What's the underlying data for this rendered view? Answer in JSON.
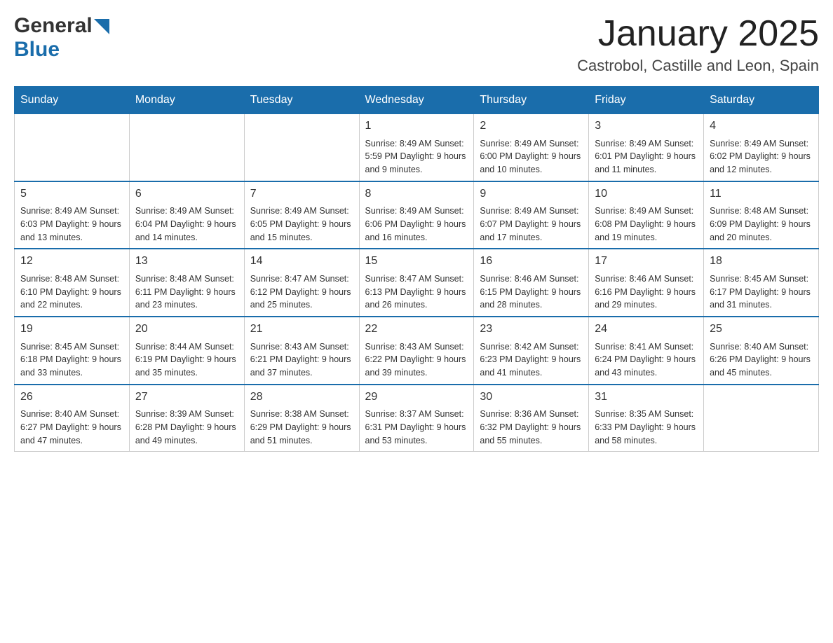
{
  "header": {
    "logo_text1": "General",
    "logo_text2": "Blue",
    "month_title": "January 2025",
    "location": "Castrobol, Castille and Leon, Spain"
  },
  "days_of_week": [
    "Sunday",
    "Monday",
    "Tuesday",
    "Wednesday",
    "Thursday",
    "Friday",
    "Saturday"
  ],
  "weeks": [
    [
      {
        "day": "",
        "info": ""
      },
      {
        "day": "",
        "info": ""
      },
      {
        "day": "",
        "info": ""
      },
      {
        "day": "1",
        "info": "Sunrise: 8:49 AM\nSunset: 5:59 PM\nDaylight: 9 hours and 9 minutes."
      },
      {
        "day": "2",
        "info": "Sunrise: 8:49 AM\nSunset: 6:00 PM\nDaylight: 9 hours and 10 minutes."
      },
      {
        "day": "3",
        "info": "Sunrise: 8:49 AM\nSunset: 6:01 PM\nDaylight: 9 hours and 11 minutes."
      },
      {
        "day": "4",
        "info": "Sunrise: 8:49 AM\nSunset: 6:02 PM\nDaylight: 9 hours and 12 minutes."
      }
    ],
    [
      {
        "day": "5",
        "info": "Sunrise: 8:49 AM\nSunset: 6:03 PM\nDaylight: 9 hours and 13 minutes."
      },
      {
        "day": "6",
        "info": "Sunrise: 8:49 AM\nSunset: 6:04 PM\nDaylight: 9 hours and 14 minutes."
      },
      {
        "day": "7",
        "info": "Sunrise: 8:49 AM\nSunset: 6:05 PM\nDaylight: 9 hours and 15 minutes."
      },
      {
        "day": "8",
        "info": "Sunrise: 8:49 AM\nSunset: 6:06 PM\nDaylight: 9 hours and 16 minutes."
      },
      {
        "day": "9",
        "info": "Sunrise: 8:49 AM\nSunset: 6:07 PM\nDaylight: 9 hours and 17 minutes."
      },
      {
        "day": "10",
        "info": "Sunrise: 8:49 AM\nSunset: 6:08 PM\nDaylight: 9 hours and 19 minutes."
      },
      {
        "day": "11",
        "info": "Sunrise: 8:48 AM\nSunset: 6:09 PM\nDaylight: 9 hours and 20 minutes."
      }
    ],
    [
      {
        "day": "12",
        "info": "Sunrise: 8:48 AM\nSunset: 6:10 PM\nDaylight: 9 hours and 22 minutes."
      },
      {
        "day": "13",
        "info": "Sunrise: 8:48 AM\nSunset: 6:11 PM\nDaylight: 9 hours and 23 minutes."
      },
      {
        "day": "14",
        "info": "Sunrise: 8:47 AM\nSunset: 6:12 PM\nDaylight: 9 hours and 25 minutes."
      },
      {
        "day": "15",
        "info": "Sunrise: 8:47 AM\nSunset: 6:13 PM\nDaylight: 9 hours and 26 minutes."
      },
      {
        "day": "16",
        "info": "Sunrise: 8:46 AM\nSunset: 6:15 PM\nDaylight: 9 hours and 28 minutes."
      },
      {
        "day": "17",
        "info": "Sunrise: 8:46 AM\nSunset: 6:16 PM\nDaylight: 9 hours and 29 minutes."
      },
      {
        "day": "18",
        "info": "Sunrise: 8:45 AM\nSunset: 6:17 PM\nDaylight: 9 hours and 31 minutes."
      }
    ],
    [
      {
        "day": "19",
        "info": "Sunrise: 8:45 AM\nSunset: 6:18 PM\nDaylight: 9 hours and 33 minutes."
      },
      {
        "day": "20",
        "info": "Sunrise: 8:44 AM\nSunset: 6:19 PM\nDaylight: 9 hours and 35 minutes."
      },
      {
        "day": "21",
        "info": "Sunrise: 8:43 AM\nSunset: 6:21 PM\nDaylight: 9 hours and 37 minutes."
      },
      {
        "day": "22",
        "info": "Sunrise: 8:43 AM\nSunset: 6:22 PM\nDaylight: 9 hours and 39 minutes."
      },
      {
        "day": "23",
        "info": "Sunrise: 8:42 AM\nSunset: 6:23 PM\nDaylight: 9 hours and 41 minutes."
      },
      {
        "day": "24",
        "info": "Sunrise: 8:41 AM\nSunset: 6:24 PM\nDaylight: 9 hours and 43 minutes."
      },
      {
        "day": "25",
        "info": "Sunrise: 8:40 AM\nSunset: 6:26 PM\nDaylight: 9 hours and 45 minutes."
      }
    ],
    [
      {
        "day": "26",
        "info": "Sunrise: 8:40 AM\nSunset: 6:27 PM\nDaylight: 9 hours and 47 minutes."
      },
      {
        "day": "27",
        "info": "Sunrise: 8:39 AM\nSunset: 6:28 PM\nDaylight: 9 hours and 49 minutes."
      },
      {
        "day": "28",
        "info": "Sunrise: 8:38 AM\nSunset: 6:29 PM\nDaylight: 9 hours and 51 minutes."
      },
      {
        "day": "29",
        "info": "Sunrise: 8:37 AM\nSunset: 6:31 PM\nDaylight: 9 hours and 53 minutes."
      },
      {
        "day": "30",
        "info": "Sunrise: 8:36 AM\nSunset: 6:32 PM\nDaylight: 9 hours and 55 minutes."
      },
      {
        "day": "31",
        "info": "Sunrise: 8:35 AM\nSunset: 6:33 PM\nDaylight: 9 hours and 58 minutes."
      },
      {
        "day": "",
        "info": ""
      }
    ]
  ]
}
